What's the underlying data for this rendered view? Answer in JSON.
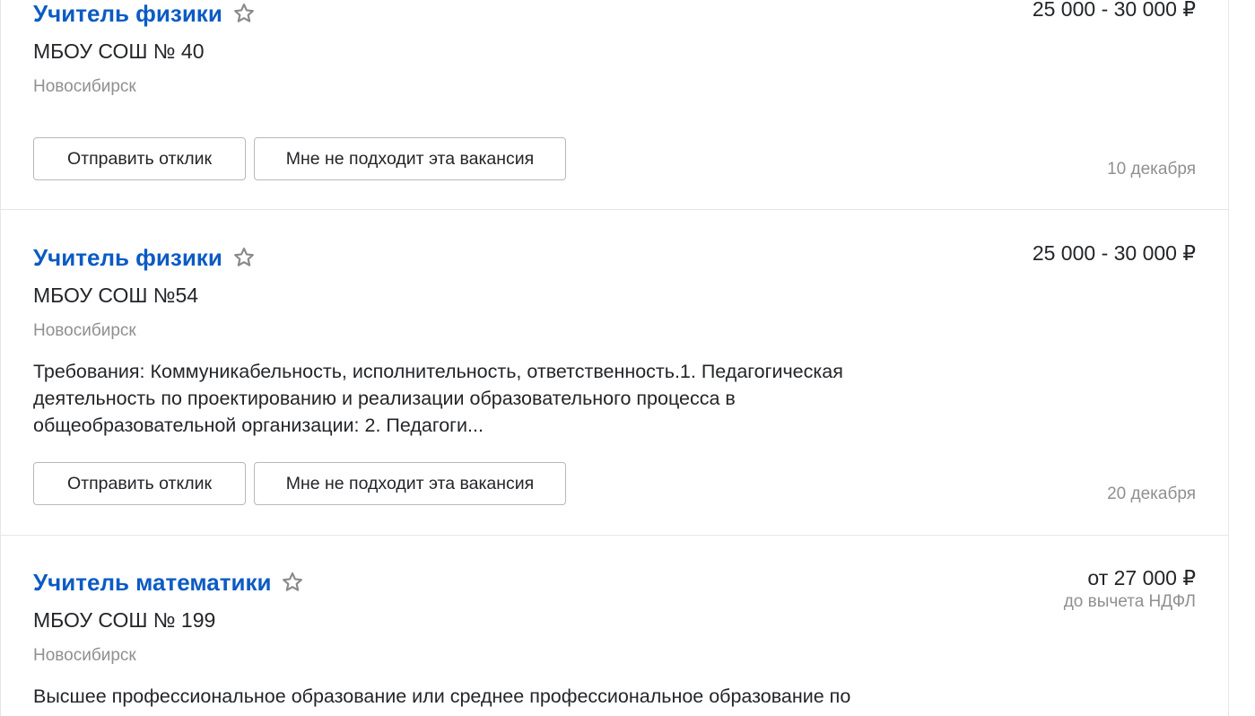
{
  "vacancies": [
    {
      "title": "Учитель физики",
      "company": "МБОУ СОШ № 40",
      "city": "Новосибирск",
      "salary": "25 000 - 30 000 ₽",
      "apply_label": "Отправить отклик",
      "reject_label": "Мне не подходит эта вакансия",
      "date": "10 декабря"
    },
    {
      "title": "Учитель физики",
      "company": "МБОУ СОШ №54",
      "city": "Новосибирск",
      "salary": "25 000 - 30 000 ₽",
      "description": "Требования: Коммуникабельность, исполнительность, ответственность.1. Педагогическая деятельность по проектированию и реализации образовательного процесса в общеобразовательной организации: 2. Педагоги...",
      "apply_label": "Отправить отклик",
      "reject_label": "Мне не подходит эта вакансия",
      "date": "20 декабря"
    },
    {
      "title": "Учитель математики",
      "company": "МБОУ СОШ № 199",
      "city": "Новосибирск",
      "salary": "от 27 000 ₽",
      "salary_note": "до вычета НДФЛ",
      "description": "Высшее профессиональное образование или среднее профессиональное образование по"
    }
  ],
  "colors": {
    "title_link": "#0b5bc4",
    "text": "#232529",
    "muted": "#909090",
    "border": "#e6e6e6",
    "button_border": "#b8b8b8",
    "star_outline": "#8a8a8a"
  },
  "icons": {
    "favorite": "star-outline-icon"
  }
}
